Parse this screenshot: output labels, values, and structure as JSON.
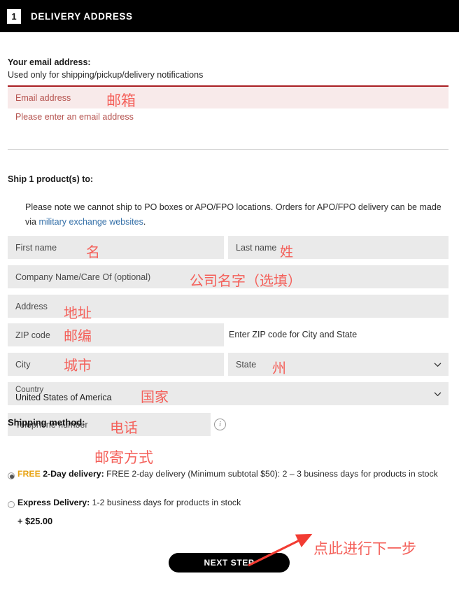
{
  "header": {
    "step_number": "1",
    "title": "DELIVERY ADDRESS"
  },
  "email_section": {
    "heading": "Your email address:",
    "subheading": "Used only for shipping/pickup/delivery notifications",
    "field_placeholder": "Email address",
    "field_value": "",
    "error_message": "Please enter an email address",
    "annotation": "邮箱"
  },
  "ship_section": {
    "title": "Ship 1 product(s) to:",
    "note_prefix": "Please note we cannot ship to PO boxes or APO/FPO locations. Orders for APO/FPO delivery can be made via ",
    "note_link": "military exchange websites",
    "note_suffix": "."
  },
  "form": {
    "first_name": {
      "label": "First name",
      "value": "",
      "annotation": "名"
    },
    "last_name": {
      "label": "Last name",
      "value": "",
      "annotation": "姓"
    },
    "company": {
      "label": "Company Name/Care Of (optional)",
      "value": "",
      "annotation": "公司名字（选填）"
    },
    "address": {
      "label": "Address",
      "value": "",
      "annotation": "地址"
    },
    "zip": {
      "label": "ZIP code",
      "value": "",
      "annotation": "邮编",
      "hint": "Enter ZIP code for City and State"
    },
    "city": {
      "label": "City",
      "value": "",
      "annotation": "城市"
    },
    "state": {
      "label": "State",
      "value": "",
      "annotation": "州"
    },
    "country": {
      "label": "Country",
      "value": "United States of America",
      "annotation": "国家"
    },
    "telephone": {
      "label": "Telephone number",
      "value": "",
      "annotation": "电话",
      "info_icon": "info-icon"
    }
  },
  "shipping_method": {
    "title": "Shipping method:",
    "annotation": "邮寄方式",
    "options": [
      {
        "selected": true,
        "badge": "FREE",
        "name": "2-Day delivery:",
        "description": "FREE 2-day delivery (Minimum subtotal $50): 2 – 3 business days for products in stock",
        "price": ""
      },
      {
        "selected": false,
        "badge": "",
        "name": "Express Delivery:",
        "description": "1-2 business days for products in stock",
        "price": "+ $25.00"
      }
    ]
  },
  "footer": {
    "next_button": "NEXT STEP",
    "next_annotation": "点此进行下一步"
  },
  "colors": {
    "header_bg": "#000000",
    "field_bg": "#eaeaea",
    "error_bg": "#f8eaea",
    "error_border": "#a91f23",
    "error_text": "#b5534f",
    "link": "#3570a8",
    "free_badge": "#e8a313",
    "annotation": "#f4605a",
    "button_bg": "#000000"
  }
}
